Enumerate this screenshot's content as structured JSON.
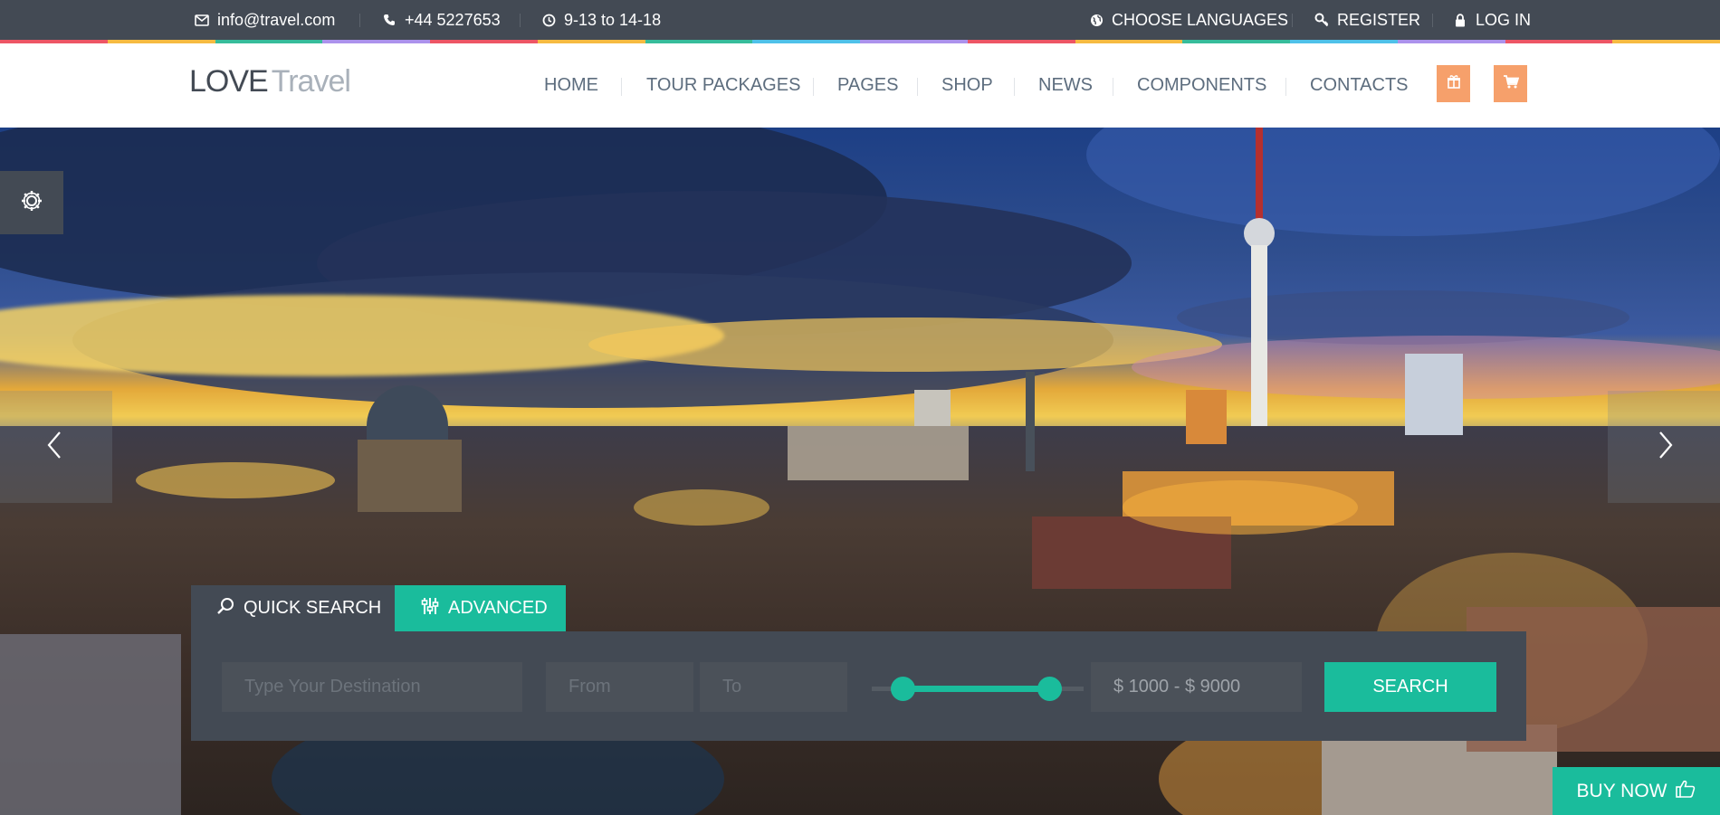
{
  "topbar": {
    "email": "info@travel.com",
    "phone": "+44 5227653",
    "hours": "9-13 to 14-18",
    "languages": "CHOOSE LANGUAGES",
    "register": "REGISTER",
    "login": "LOG IN"
  },
  "header": {
    "logo_primary": "LOVE",
    "logo_secondary": "Travel",
    "nav": [
      "HOME",
      "TOUR PACKAGES",
      "PAGES",
      "SHOP",
      "NEWS",
      "COMPONENTS",
      "CONTACTS"
    ],
    "gift_icon": "gift-icon",
    "cart_icon": "cart-icon"
  },
  "search": {
    "tab_quick": "QUICK SEARCH",
    "tab_advanced": "ADVANCED",
    "destination_placeholder": "Type Your Destination",
    "from_placeholder": "From",
    "to_placeholder": "To",
    "price_range": "$ 1000 - $ 9000",
    "button": "SEARCH"
  },
  "buy_now": "BUY NOW",
  "colors": {
    "topbar": "#434a54",
    "accent_teal": "#1abc9c",
    "accent_orange": "#f6a06b",
    "nav_text": "#5d6d7e"
  }
}
